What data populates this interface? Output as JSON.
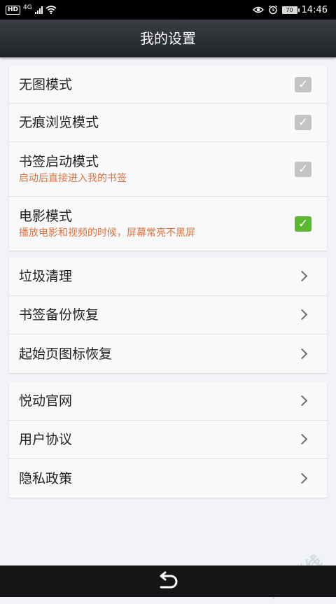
{
  "status_bar": {
    "hd_label": "HD",
    "network": "4G",
    "battery": "70",
    "time": "14:46"
  },
  "header": {
    "title": "我的设置"
  },
  "toggles": [
    {
      "label": "无图模式",
      "checked": false
    },
    {
      "label": "无痕浏览模式",
      "checked": false
    },
    {
      "label": "书签启动模式",
      "sub": "启动后直接进入我的书签",
      "checked": false
    },
    {
      "label": "电影模式",
      "sub": "播放电影和视频的时候，屏幕常亮不黑屏",
      "checked": true
    }
  ],
  "tools": [
    {
      "label": "垃圾清理"
    },
    {
      "label": "书签备份恢复"
    },
    {
      "label": "起始页图标恢复"
    }
  ],
  "about": [
    {
      "label": "悦动官网"
    },
    {
      "label": "用户协议"
    },
    {
      "label": "隐私政策"
    }
  ],
  "watermark": "日开迷线",
  "colors": {
    "accent_green": "#5cb833",
    "subtitle_orange": "#e0703a",
    "checkbox_off": "#c4c4c4"
  }
}
